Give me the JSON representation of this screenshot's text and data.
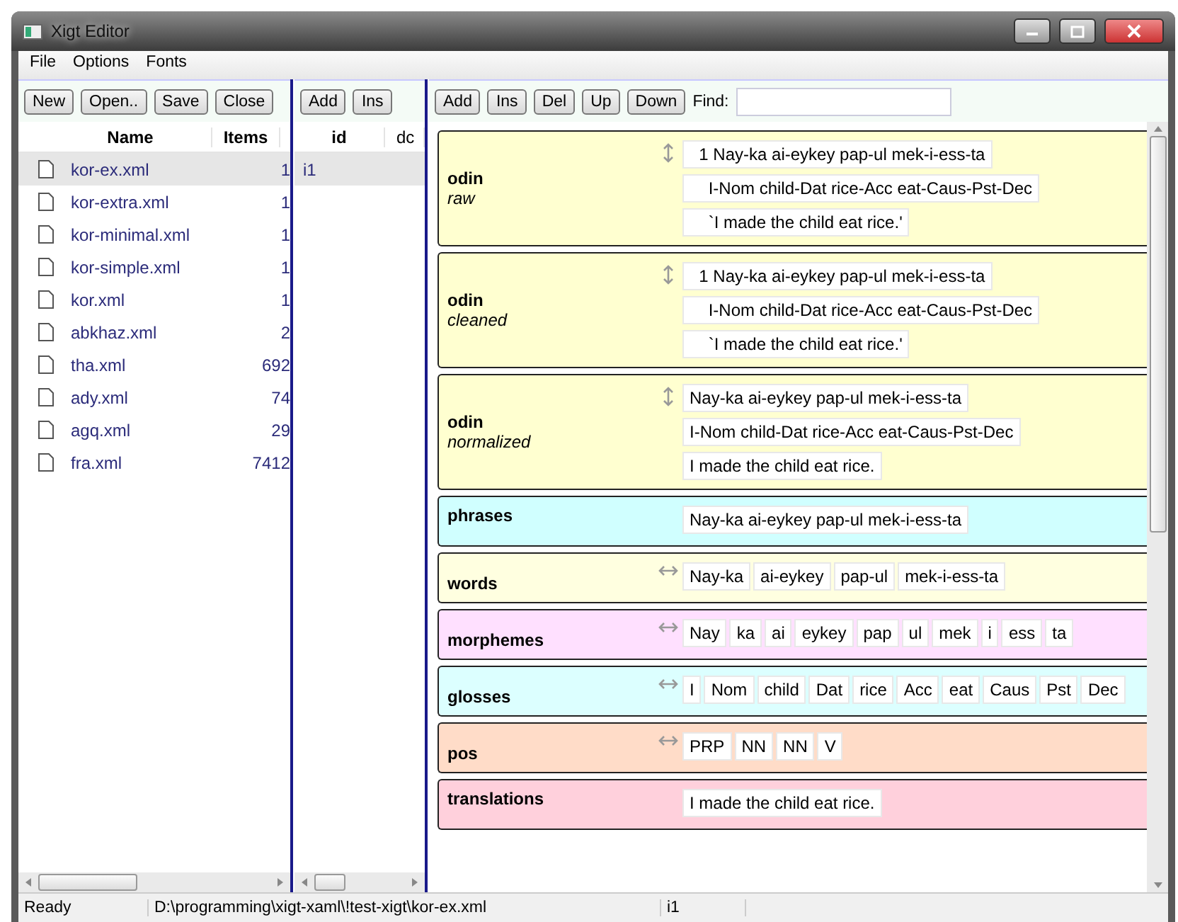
{
  "window": {
    "title": "Xigt Editor"
  },
  "menu": [
    "File",
    "Options",
    "Fonts"
  ],
  "file_toolbar": [
    "New",
    "Open..",
    "Save",
    "Close"
  ],
  "files": {
    "columns": [
      "Name",
      "Items"
    ],
    "rows": [
      {
        "name": "kor-ex.xml",
        "items": "1",
        "selected": true
      },
      {
        "name": "kor-extra.xml",
        "items": "1",
        "selected": false
      },
      {
        "name": "kor-minimal.xml",
        "items": "1",
        "selected": false
      },
      {
        "name": "kor-simple.xml",
        "items": "1",
        "selected": false
      },
      {
        "name": "kor.xml",
        "items": "1",
        "selected": false
      },
      {
        "name": "abkhaz.xml",
        "items": "2",
        "selected": false
      },
      {
        "name": "tha.xml",
        "items": "692",
        "selected": false
      },
      {
        "name": "ady.xml",
        "items": "74",
        "selected": false
      },
      {
        "name": "agq.xml",
        "items": "29",
        "selected": false
      },
      {
        "name": "fra.xml",
        "items": "7412",
        "selected": false
      }
    ]
  },
  "igt_toolbar": [
    "Add",
    "Ins"
  ],
  "igts": {
    "columns": [
      "id",
      "dc"
    ],
    "rows": [
      {
        "id": "i1",
        "selected": true
      }
    ]
  },
  "tier_toolbar": {
    "buttons": [
      "Add",
      "Ins",
      "Del",
      "Up",
      "Down"
    ],
    "find_label": "Find:"
  },
  "tiers": [
    {
      "kind": "odin",
      "name": "odin",
      "state": "raw",
      "color": "#ffffd0",
      "items": [
        "  1 Nay-ka ai-eykey pap-ul mek-i-ess-ta",
        "    I-Nom child-Dat rice-Acc eat-Caus-Pst-Dec",
        "    `I made the child eat rice.'"
      ]
    },
    {
      "kind": "odin",
      "name": "odin",
      "state": "cleaned",
      "color": "#ffffd0",
      "items": [
        "  1 Nay-ka ai-eykey pap-ul mek-i-ess-ta",
        "    I-Nom child-Dat rice-Acc eat-Caus-Pst-Dec",
        "    `I made the child eat rice.'"
      ]
    },
    {
      "kind": "odin",
      "name": "odin",
      "state": "normalized",
      "color": "#ffffd0",
      "items": [
        "Nay-ka ai-eykey pap-ul mek-i-ess-ta",
        "I-Nom child-Dat rice-Acc eat-Caus-Pst-Dec",
        "I made the child eat rice."
      ]
    },
    {
      "kind": "phrases",
      "name": "phrases",
      "color": "#d0ffff",
      "items": [
        "Nay-ka ai-eykey pap-ul mek-i-ess-ta"
      ]
    },
    {
      "kind": "tokens",
      "name": "words",
      "color": "#ffffe0",
      "items": [
        "Nay-ka",
        "ai-eykey",
        "pap-ul",
        "mek-i-ess-ta"
      ]
    },
    {
      "kind": "tokens",
      "name": "morphemes",
      "color": "#ffe0ff",
      "items": [
        "Nay",
        "ka",
        "ai",
        "eykey",
        "pap",
        "ul",
        "mek",
        "i",
        "ess",
        "ta"
      ]
    },
    {
      "kind": "tokens",
      "name": "glosses",
      "color": "#dcffff",
      "items": [
        "I",
        "Nom",
        "child",
        "Dat",
        "rice",
        "Acc",
        "eat",
        "Caus",
        "Pst",
        "Dec"
      ]
    },
    {
      "kind": "tokens",
      "name": "pos",
      "color": "#ffdcc8",
      "items": [
        "PRP",
        "NN",
        "NN",
        "V"
      ]
    },
    {
      "kind": "phrases",
      "name": "translations",
      "color": "#ffd0dc",
      "items": [
        "I made the child eat rice."
      ]
    }
  ],
  "status_bar": {
    "message": "Ready",
    "path": "D:\\programming\\xigt-xaml\\!test-xigt\\kor-ex.xml",
    "item": "i1"
  }
}
